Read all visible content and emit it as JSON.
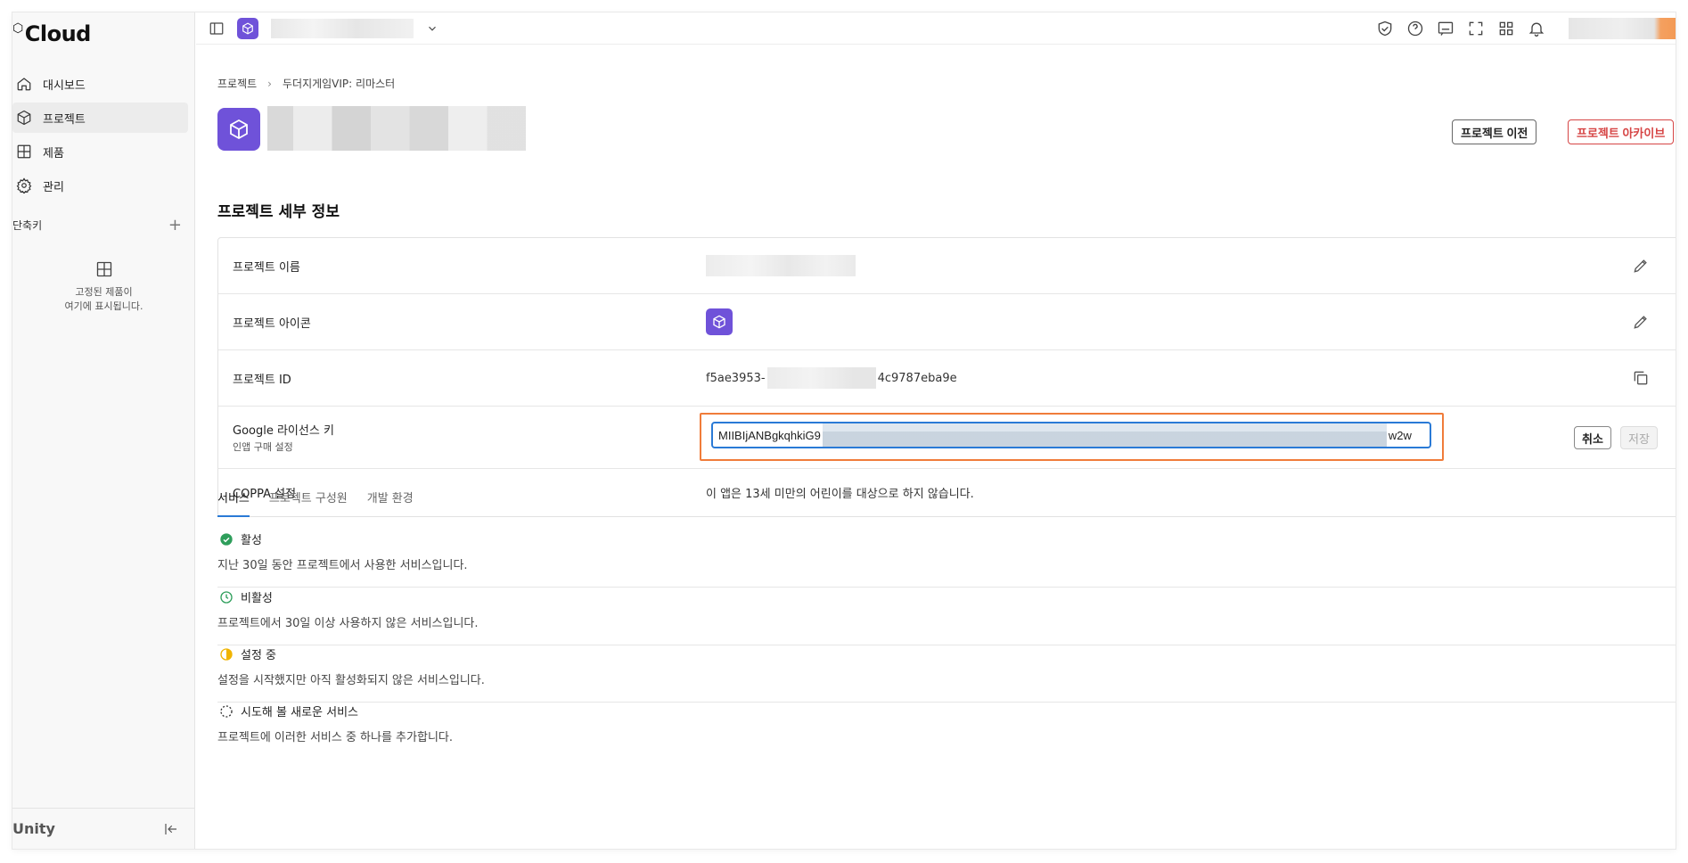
{
  "sidebar": {
    "logo": "Cloud",
    "items": [
      {
        "label": "대시보드",
        "icon": "home-icon"
      },
      {
        "label": "프로젝트",
        "icon": "cube-icon",
        "active": true
      },
      {
        "label": "제품",
        "icon": "grid-icon"
      },
      {
        "label": "관리",
        "icon": "gear-icon"
      }
    ],
    "shortcuts_label": "단축키",
    "pinned_text_1": "고정된 제품이",
    "pinned_text_2": "여기에 표시됩니다.",
    "bottom_logo": "Unity"
  },
  "topbar": {
    "icons": [
      "shield-check-icon",
      "help-icon",
      "feedback-icon",
      "fullscreen-icon",
      "apps-icon",
      "bell-icon"
    ]
  },
  "breadcrumb": {
    "root": "프로젝트",
    "current": "두더지게임VIP: 리마스터"
  },
  "header": {
    "transfer_button": "프로젝트 이전",
    "archive_button": "프로젝트 아카이브"
  },
  "details": {
    "title": "프로젝트 세부 정보",
    "rows": {
      "name_label": "프로젝트 이름",
      "icon_label": "프로젝트 아이콘",
      "id_label": "프로젝트 ID",
      "id_prefix": "f5ae3953-",
      "id_suffix": "4c9787eba9e",
      "license_label": "Google 라이선스 키",
      "license_sub": "인앱 구매 설정",
      "license_value_start": "MIIBIjANBgkqhkiG9",
      "license_value_end": "w2w",
      "cancel_button": "취소",
      "save_button": "저장",
      "coppa_label": "COPPA 설정",
      "coppa_value": "이 앱은 13세 미만의 어린이를 대상으로 하지 않습니다."
    }
  },
  "tabs": [
    {
      "label": "서비스",
      "active": true
    },
    {
      "label": "프로젝트 구성원"
    },
    {
      "label": "개발 환경"
    }
  ],
  "services": [
    {
      "title": "활성",
      "desc": "지난 30일 동안 프로젝트에서 사용한 서비스입니다.",
      "color": "#2e9e5b"
    },
    {
      "title": "비활성",
      "desc": "프로젝트에서 30일 이상 사용하지 않은 서비스입니다.",
      "color": "#2e9e5b"
    },
    {
      "title": "설정 중",
      "desc": "설정을 시작했지만 아직 활성화되지 않은 서비스입니다.",
      "color": "#f0b400"
    },
    {
      "title": "시도해 볼 새로운 서비스",
      "desc": "프로젝트에 이러한 서비스 중 하나를 추가합니다.",
      "color": "#333333"
    }
  ],
  "colors": {
    "accent": "#2a7ad6",
    "brand": "#6f52d9",
    "danger": "#d64545",
    "highlight": "#f07c3a"
  }
}
